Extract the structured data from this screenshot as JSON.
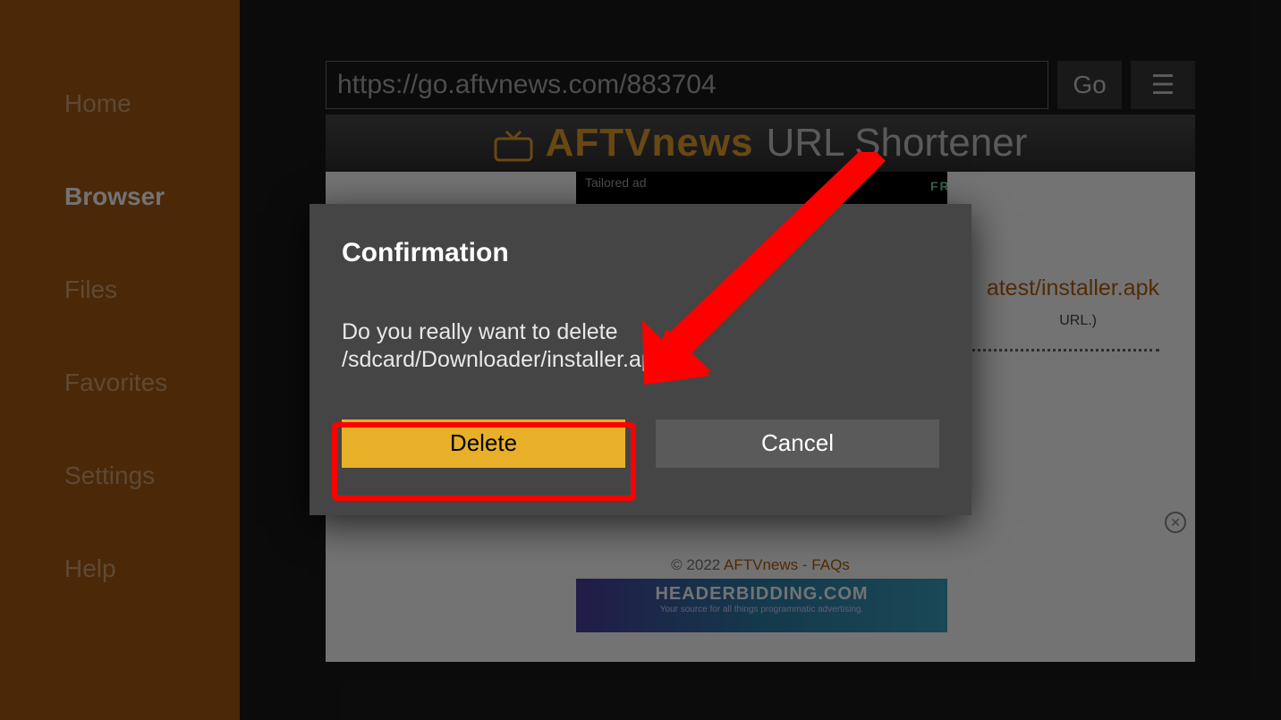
{
  "sidebar": {
    "items": [
      {
        "label": "Home",
        "active": false
      },
      {
        "label": "Browser",
        "active": true
      },
      {
        "label": "Files",
        "active": false
      },
      {
        "label": "Favorites",
        "active": false
      },
      {
        "label": "Settings",
        "active": false
      },
      {
        "label": "Help",
        "active": false
      }
    ]
  },
  "urlbar": {
    "value": "https://go.aftvnews.com/883704",
    "go_label": "Go",
    "menu_glyph": "☰"
  },
  "page_header": {
    "brand": "AFTVnews",
    "subtitle": "URL Shortener"
  },
  "content": {
    "ad_text": "Tailored ad",
    "ad_free": "FRE",
    "installer_link_text": "atest/installer.apk",
    "installer_note": "URL.)",
    "footer_copy": "© 2022 ",
    "footer_link1": "AFTVnews",
    "footer_sep": " - ",
    "footer_link2": "FAQs",
    "hb_title": "HEADERBIDDING.COM",
    "hb_sub": "Your source for all things programmatic advertising."
  },
  "dialog": {
    "title": "Confirmation",
    "message": "Do you really want to delete /sdcard/Downloader/installer.apk ?",
    "delete_label": "Delete",
    "cancel_label": "Cancel"
  },
  "colors": {
    "accent_orange": "#a75a12",
    "highlight_yellow": "#e8b028",
    "red": "#ff0000"
  }
}
